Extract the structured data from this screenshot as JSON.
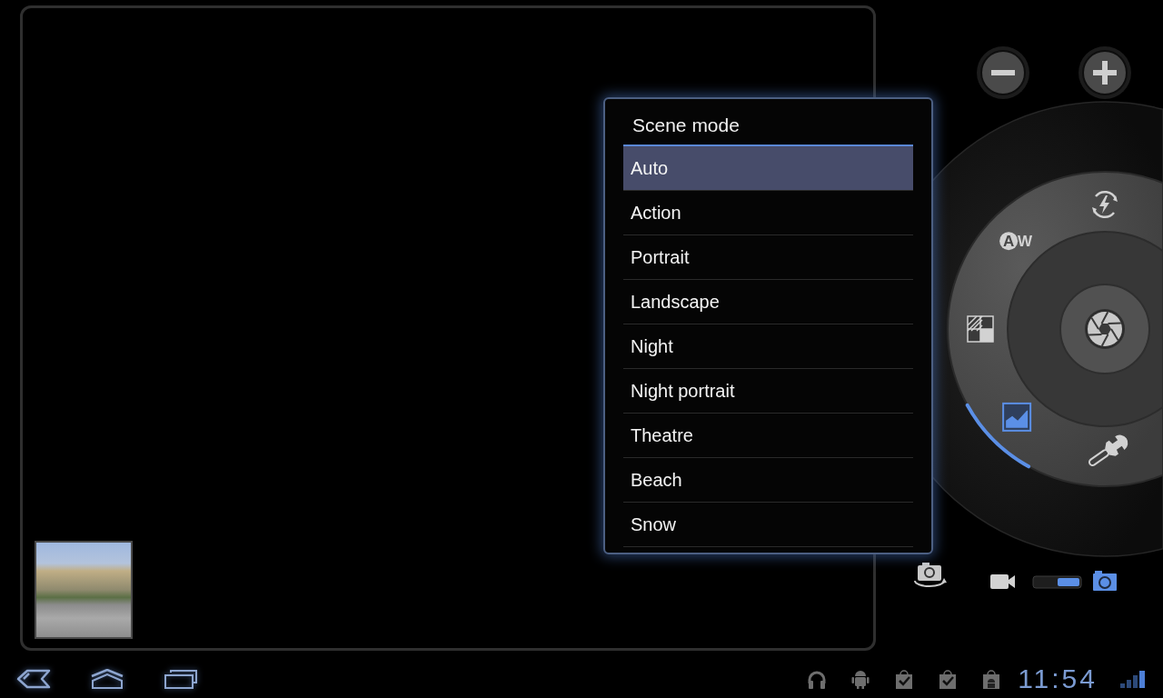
{
  "scene_menu": {
    "title": "Scene mode",
    "items": [
      {
        "label": "Auto",
        "selected": true
      },
      {
        "label": "Action",
        "selected": false
      },
      {
        "label": "Portrait",
        "selected": false
      },
      {
        "label": "Landscape",
        "selected": false
      },
      {
        "label": "Night",
        "selected": false
      },
      {
        "label": "Night portrait",
        "selected": false
      },
      {
        "label": "Theatre",
        "selected": false
      },
      {
        "label": "Beach",
        "selected": false
      },
      {
        "label": "Snow",
        "selected": false
      }
    ]
  },
  "dial": {
    "items": [
      {
        "kind": "flash",
        "selected": false
      },
      {
        "kind": "white_balance",
        "circled_letter": "A",
        "letter": "W",
        "selected": false
      },
      {
        "kind": "exposure",
        "selected": false
      },
      {
        "kind": "scene",
        "selected": true
      },
      {
        "kind": "settings",
        "selected": false
      }
    ]
  },
  "mode_switch": {
    "modes": [
      {
        "kind": "video",
        "selected": false
      },
      {
        "kind": "photo",
        "selected": true
      }
    ]
  },
  "status_bar": {
    "time": "11:54"
  }
}
